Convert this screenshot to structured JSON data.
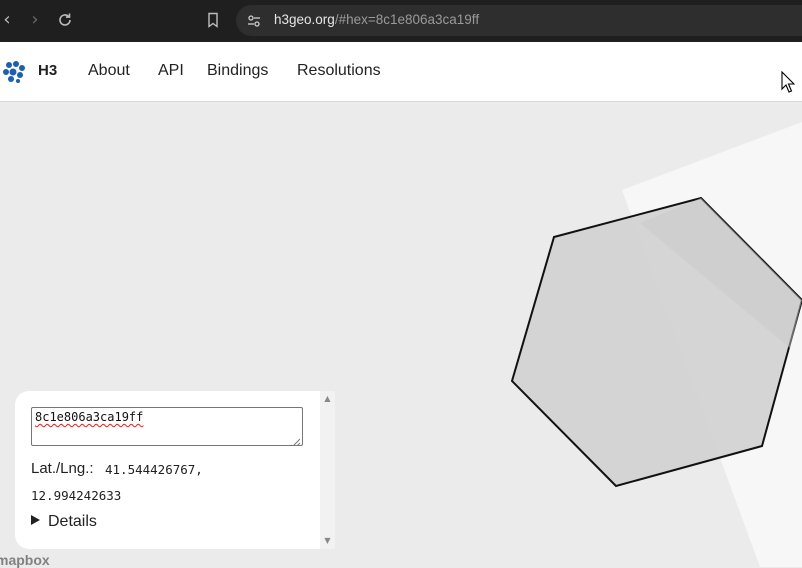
{
  "browser": {
    "url_host": "h3geo.org",
    "url_path": "/#hex=8c1e806a3ca19ff"
  },
  "site": {
    "brand": "H3",
    "nav": [
      {
        "label": "About"
      },
      {
        "label": "API"
      },
      {
        "label": "Bindings"
      },
      {
        "label": "Resolutions"
      }
    ]
  },
  "panel": {
    "hex_value": "8c1e806a3ca19ff",
    "latlng_label": "Lat./Lng.:",
    "lat": "41.544426767,",
    "lng": "12.994242633",
    "details_label": "Details"
  },
  "map": {
    "attribution": "mapbox",
    "hex_fill": "#d3d3d3",
    "hex_stroke": "#111111"
  },
  "colors": {
    "accent": "#1a5fb4",
    "map_bg": "#ebebeb"
  }
}
